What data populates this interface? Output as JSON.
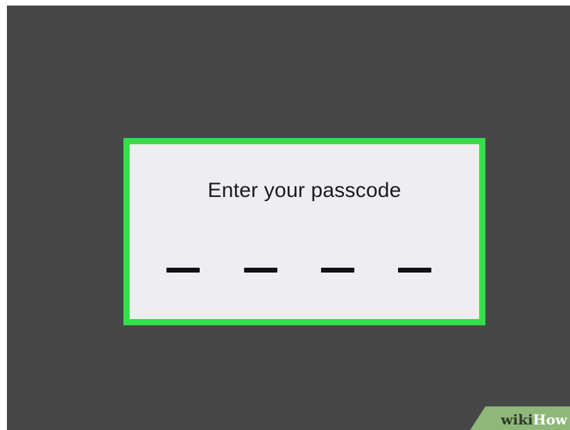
{
  "passcode": {
    "prompt": "Enter your passcode",
    "digit_slots": 4,
    "highlight_color": "#33e04a"
  },
  "watermark": {
    "part1": "wiki",
    "part2": "How"
  }
}
